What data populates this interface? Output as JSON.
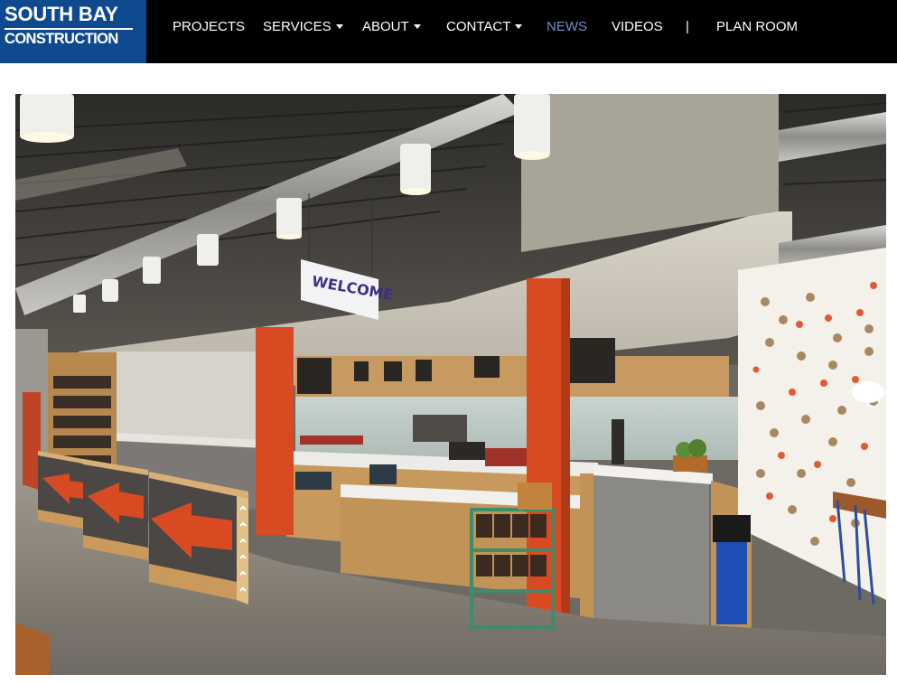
{
  "logo": {
    "line1": "SOUTH BAY",
    "line2": "CONSTRUCTION",
    "background": "#0f4a8f"
  },
  "nav": {
    "items": [
      {
        "label": "PROJECTS",
        "dropdown": false,
        "active": false
      },
      {
        "label": "SERVICES",
        "dropdown": true,
        "active": false
      },
      {
        "label": "ABOUT",
        "dropdown": true,
        "active": false
      },
      {
        "label": "CONTACT",
        "dropdown": true,
        "active": false
      },
      {
        "label": "NEWS",
        "dropdown": false,
        "active": true
      },
      {
        "label": "VIDEOS",
        "dropdown": false,
        "active": false
      },
      {
        "label": "PLAN ROOM",
        "dropdown": false,
        "active": false
      }
    ],
    "separator": "|",
    "active_color": "#6c8fc7"
  },
  "photo": {
    "sign_text": "WELCOME",
    "accent_color": "#d84a22"
  }
}
